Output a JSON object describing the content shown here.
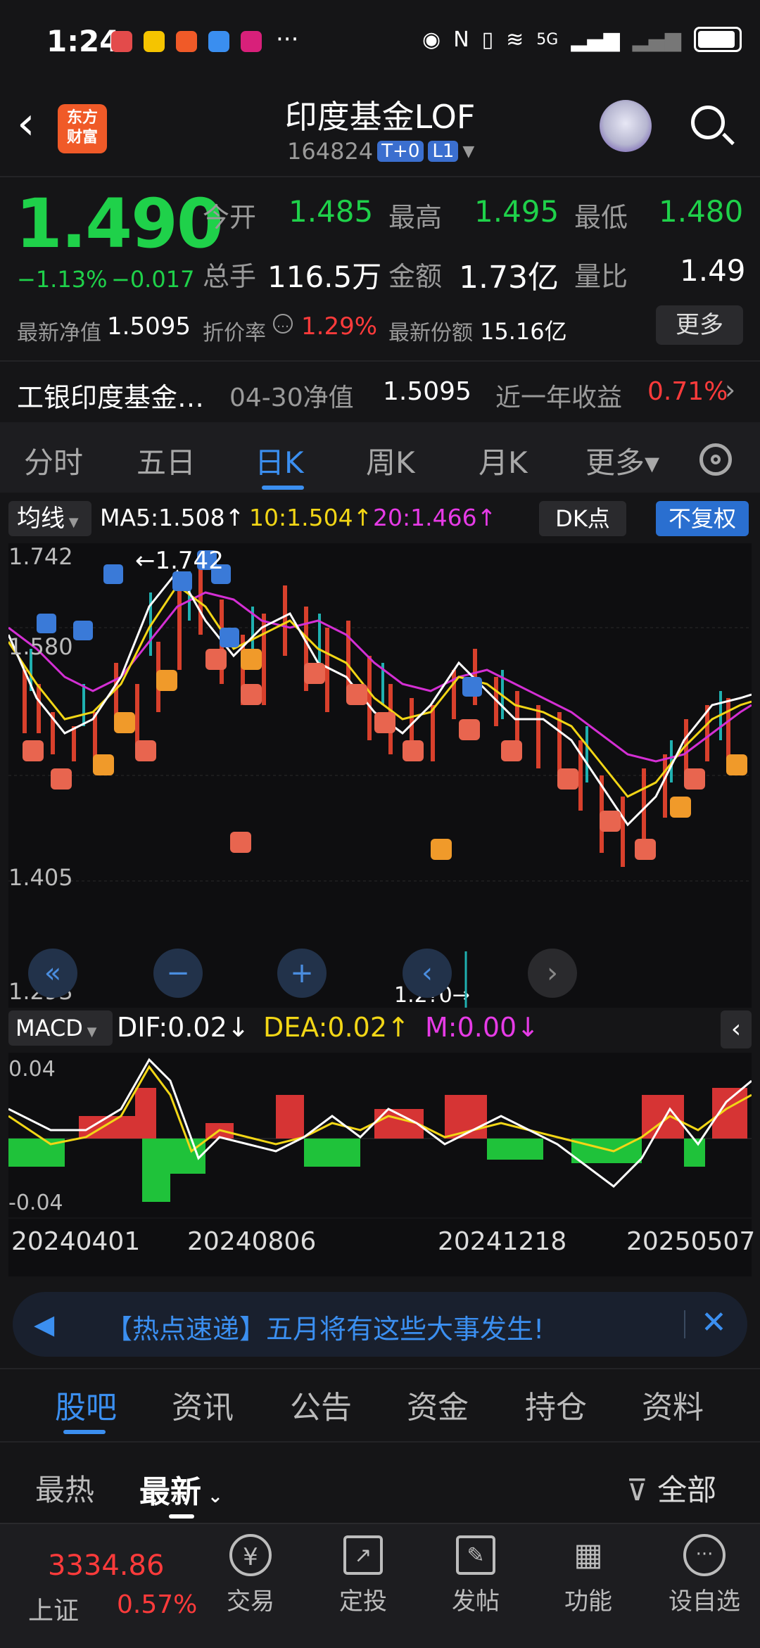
{
  "status_bar": {
    "time": "1:24",
    "dots": "···",
    "network": "5G"
  },
  "header": {
    "logo_text": "东方\n财富",
    "title": "印度基金LOF",
    "code": "164824",
    "badge1": "T+0",
    "badge2": "L1"
  },
  "quote": {
    "price": "1.490",
    "change_pct": "−1.13%",
    "change": "−0.017",
    "open_label": "今开",
    "open": "1.485",
    "high_label": "最高",
    "high": "1.495",
    "low_label": "最低",
    "low": "1.480",
    "volume_label": "总手",
    "volume": "116.5万",
    "amount_label": "金额",
    "amount": "1.73亿",
    "ratio_label": "量比",
    "ratio": "1.49",
    "nav_label": "最新净值",
    "nav": "1.5095",
    "discount_label": "折价率",
    "discount": "1.29%",
    "shares_label": "最新份额",
    "shares": "15.16亿",
    "more": "更多"
  },
  "fund_line": {
    "name": "工银印度基金…",
    "nav_date_label": "04-30净值",
    "nav": "1.5095",
    "yield_label": "近一年收益",
    "yield": "0.71%"
  },
  "chart_tabs": [
    "分时",
    "五日",
    "日K",
    "周K",
    "月K",
    "更多▾"
  ],
  "ma_bar": {
    "selector": "均线",
    "ma5": "MA5:1.508↑",
    "ma10": "10:1.504↑",
    "ma20": "20:1.466↑",
    "dk": "DK点",
    "adjust": "不复权"
  },
  "kline": {
    "y_top": "1.742",
    "y_mid": "1.580",
    "y_low": "1.405",
    "y_bottom": "1.293",
    "peak_label": "←1.742",
    "low_label": "1.2?0→"
  },
  "macd_bar": {
    "selector": "MACD",
    "dif": "DIF:0.02↓",
    "dea": "DEA:0.02↑",
    "m": "M:0.00↓",
    "y_top": "0.04",
    "y_bottom": "-0.04"
  },
  "dates": [
    "20240401",
    "20240806",
    "20241218",
    "20250507"
  ],
  "banner": {
    "text": "【热点速递】五月将有这些大事发生!"
  },
  "section_tabs": [
    "股吧",
    "资讯",
    "公告",
    "资金",
    "持仓",
    "资料"
  ],
  "sort": {
    "hot": "最热",
    "new": "最新",
    "filter": "全部"
  },
  "bottom_nav": {
    "index_value": "3334.86",
    "index_name": "上证",
    "index_pct": "0.57%",
    "items": [
      "交易",
      "定投",
      "发帖",
      "功能",
      "设自选"
    ]
  },
  "colors": {
    "up": "#ff3b3b",
    "down": "#1fd14a",
    "accent": "#3b8ff0",
    "bg": "#151517"
  }
}
